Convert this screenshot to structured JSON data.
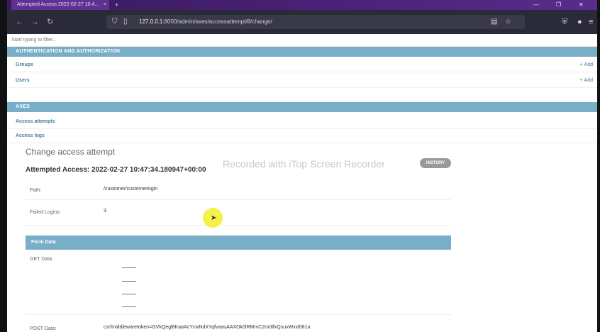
{
  "browser": {
    "tab_title": "Attempted Access 2022-02-27 10:4...",
    "tab_close": "×",
    "new_tab": "+",
    "url_host": "127.0.0.1",
    "url_path": ":8000/admin/axes/accessattempt/8/change/",
    "window_controls": [
      "—",
      "❐",
      "✕"
    ]
  },
  "admin": {
    "filter_placeholder": "Start typing to filter...",
    "auth_module": {
      "caption": "AUTHENTICATION AND AUTHORIZATION",
      "rows": [
        {
          "label": "Groups",
          "add": "Add"
        },
        {
          "label": "Users",
          "add": "Add"
        }
      ]
    },
    "axes_module": {
      "caption": "AXES",
      "rows": [
        {
          "label": "Access attempts"
        },
        {
          "label": "Access logs"
        }
      ]
    },
    "content_title": "Change access attempt",
    "object_heading": "Attempted Access: 2022-02-27 10:47:34.180947+00:00",
    "history_button": "HISTORY",
    "fields": [
      {
        "label": "Path:",
        "value": "/customer/customerlogin"
      },
      {
        "label": "Failed Logins:",
        "value": "3"
      }
    ],
    "form_data": {
      "caption": "Form Data",
      "get_label": "GET Data:",
      "post_label": "POST Data:",
      "post_value": "csrfmiddlewaretoken=GVkQegl8KaaAcYcwNdXYqfvaauAAXOk0lRMrvC2ro0lfxQsuvWxxl081a"
    }
  },
  "overlay": {
    "watermark": "Recorded with iTop Screen Recorder"
  }
}
